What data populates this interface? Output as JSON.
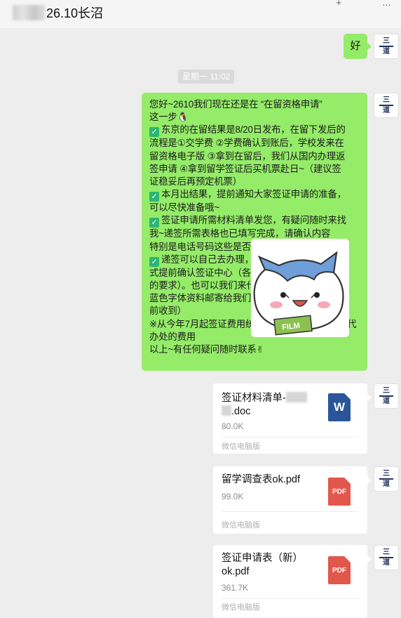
{
  "header": {
    "title": "26.10长沼"
  },
  "avatar": {
    "text_line1": "三",
    "text_line2": "道"
  },
  "messages": {
    "reply_ok": "好",
    "timestamp": "星期一 11:02",
    "long_lines": [
      "您好~2610我们现在还是在 “在留资格申请”",
      "这一步",
      "东京的在留结果是8/20日发布，在留下发后的",
      "流程是①交学费 ②学费确认到账后，学校发来在",
      "留资格电子版 ③拿到在留后，我们从国内办理返",
      "签申请 ④拿到留学签证后买机票赴日~（建议签",
      "证稳妥后再预定机票）",
      "本月出结果，提前通知大家签证申请的准备，",
      "可以尽快准备哦~",
      "签证申请所需材料清单发您，有疑问随时来找",
      "我~递签所需表格也已填写完成，请确认内容",
      "特别是电话号码这些是否正确",
      "递签可以自己去办理，也可以找代办的方",
      "式提前确认签证中心（各个区域签证中心有不同",
      "的要求）。也可以我们来代办~需要代办的请把",
      "蓝色字体资料邮寄给我们（最迟8月20",
      "前收到）",
      "※从今年7月起签证费用统一上涨，同时需要支付代",
      "办处的费用",
      "以上~有任何疑问随时联系"
    ]
  },
  "files": [
    {
      "name_part1": "签证材料清单-",
      "name_part2": ".doc",
      "size": "80.0K",
      "source": "微信电脑版",
      "type": "W"
    },
    {
      "name": "留学调查表ok.pdf",
      "size": "99.0K",
      "source": "微信电脑版",
      "type": "PDF"
    },
    {
      "name_part1": "签证申请表（新）",
      "name_part2": "ok.pdf",
      "size": "361.7K",
      "source": "微信电脑版",
      "type": "PDF"
    }
  ],
  "sticker": {
    "banner": "FILM"
  },
  "icons": {
    "header_actions": [
      "plus-icon",
      "more-icon"
    ],
    "check": "check-mark-icon",
    "penguin": "penguin-emoji-icon",
    "victory": "victory-hand-emoji-icon"
  },
  "colors": {
    "bubble_green": "#95ec69",
    "check_green": "#2bb673",
    "doc_blue": "#2a5699",
    "pdf_red": "#e2574c",
    "background": "#ededed"
  }
}
